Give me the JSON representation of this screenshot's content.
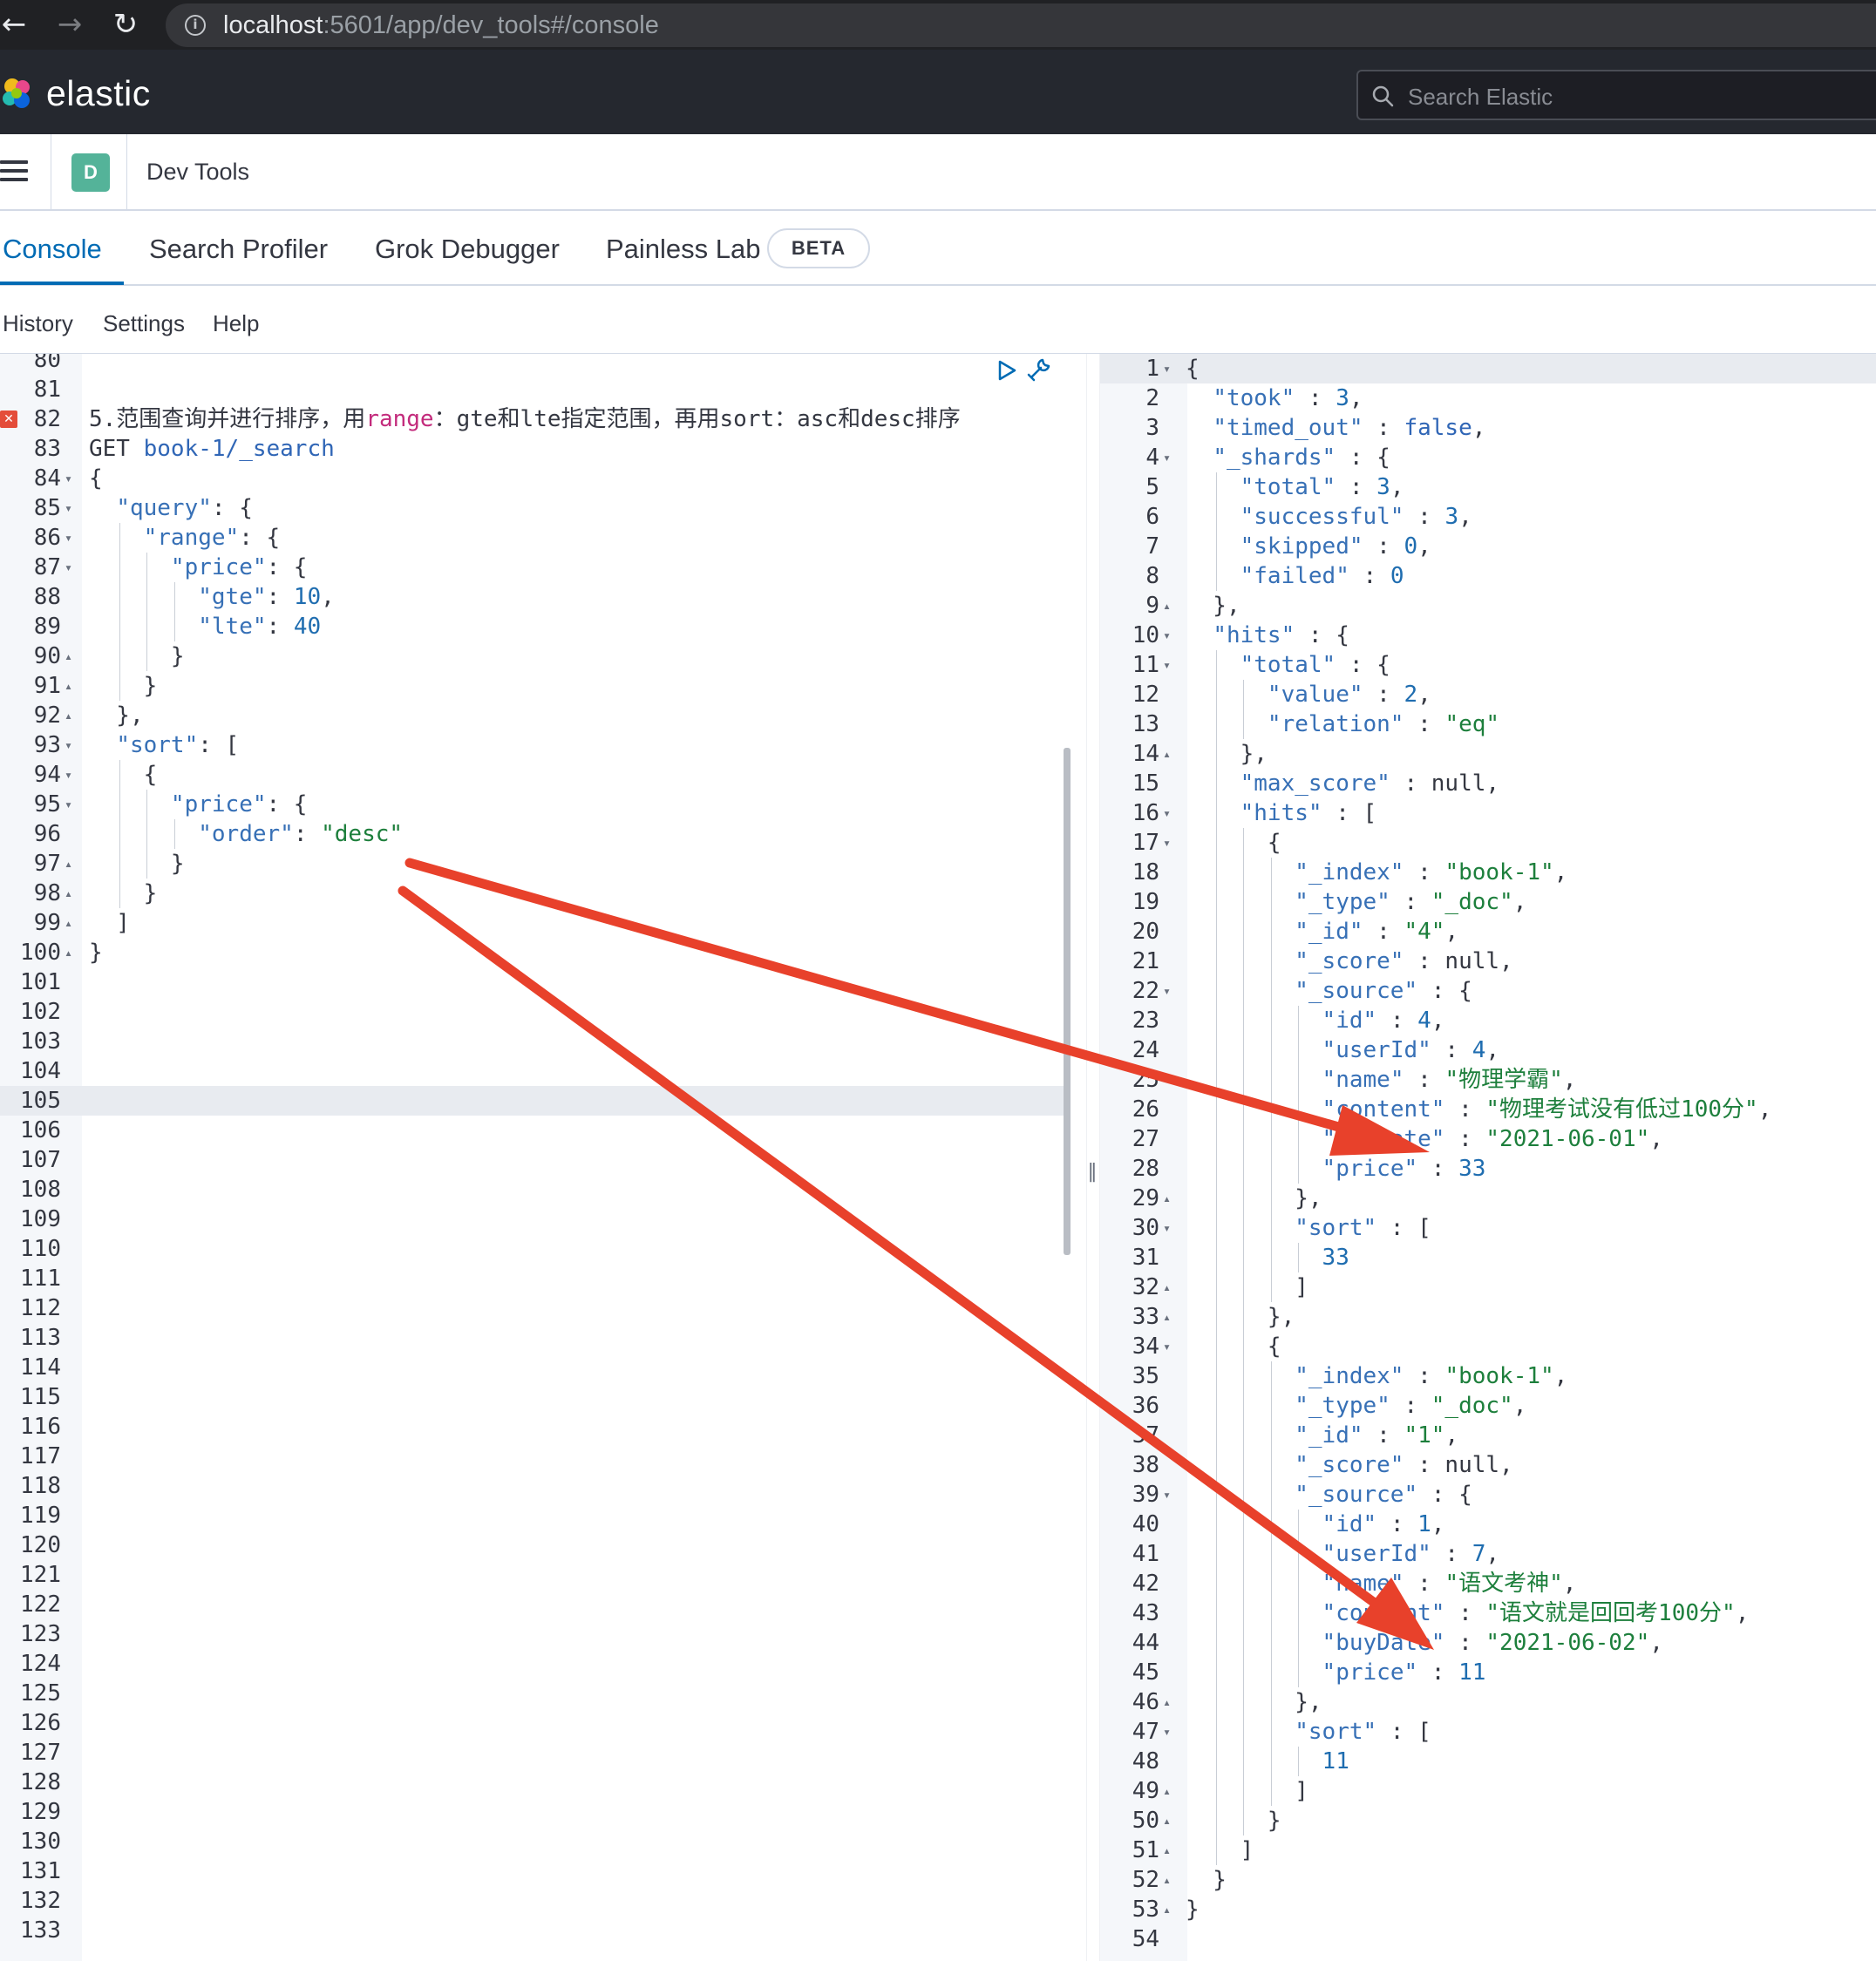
{
  "browser": {
    "url_host": "localhost",
    "url_rest": ":5601/app/dev_tools#/console",
    "back_icon": "←",
    "forward_icon": "→",
    "reload_icon": "↻"
  },
  "header": {
    "brand": "elastic",
    "search_placeholder": "Search Elastic"
  },
  "breadcrumb": {
    "app_badge": "D",
    "title": "Dev Tools"
  },
  "tabs": [
    {
      "label": "Console",
      "active": true
    },
    {
      "label": "Search Profiler"
    },
    {
      "label": "Grok Debugger"
    },
    {
      "label": "Painless Lab"
    }
  ],
  "beta_badge": "BETA",
  "menu": [
    "History",
    "Settings",
    "Help"
  ],
  "colors": {
    "accent": "#006bb4",
    "arrow": "#e8412b",
    "header": "#25282f"
  },
  "request_lines": [
    {
      "n": "80",
      "code": ""
    },
    {
      "n": "81",
      "code": ""
    },
    {
      "n": "82",
      "code": "5.范围查询并进行排序，用range：gte和lte指定范围，再用sort：asc和desc排序",
      "error": true
    },
    {
      "n": "83",
      "code": "GET book-1/_search"
    },
    {
      "n": "84",
      "fold": "▾",
      "code": "{"
    },
    {
      "n": "85",
      "fold": "▾",
      "code": "  \"query\": {"
    },
    {
      "n": "86",
      "fold": "▾",
      "code": "    \"range\": {"
    },
    {
      "n": "87",
      "fold": "▾",
      "code": "      \"price\": {"
    },
    {
      "n": "88",
      "code": "        \"gte\": 10,"
    },
    {
      "n": "89",
      "code": "        \"lte\": 40"
    },
    {
      "n": "90",
      "fold": "▴",
      "code": "      }"
    },
    {
      "n": "91",
      "fold": "▴",
      "code": "    }"
    },
    {
      "n": "92",
      "fold": "▴",
      "code": "  },"
    },
    {
      "n": "93",
      "fold": "▾",
      "code": "  \"sort\": ["
    },
    {
      "n": "94",
      "fold": "▾",
      "code": "    {"
    },
    {
      "n": "95",
      "fold": "▾",
      "code": "      \"price\": {"
    },
    {
      "n": "96",
      "code": "        \"order\": \"desc\""
    },
    {
      "n": "97",
      "fold": "▴",
      "code": "      }"
    },
    {
      "n": "98",
      "fold": "▴",
      "code": "    }"
    },
    {
      "n": "99",
      "fold": "▴",
      "code": "  ]"
    },
    {
      "n": "100",
      "fold": "▴",
      "code": "}"
    },
    {
      "n": "101",
      "code": ""
    },
    {
      "n": "102",
      "code": ""
    },
    {
      "n": "103",
      "code": ""
    },
    {
      "n": "104",
      "code": ""
    },
    {
      "n": "105",
      "code": "",
      "active": true
    },
    {
      "n": "106",
      "code": ""
    },
    {
      "n": "107",
      "code": ""
    },
    {
      "n": "108",
      "code": ""
    },
    {
      "n": "109",
      "code": ""
    },
    {
      "n": "110",
      "code": ""
    },
    {
      "n": "111",
      "code": ""
    },
    {
      "n": "112",
      "code": ""
    },
    {
      "n": "113",
      "code": ""
    },
    {
      "n": "114",
      "code": ""
    },
    {
      "n": "115",
      "code": ""
    },
    {
      "n": "116",
      "code": ""
    },
    {
      "n": "117",
      "code": ""
    },
    {
      "n": "118",
      "code": ""
    },
    {
      "n": "119",
      "code": ""
    },
    {
      "n": "120",
      "code": ""
    },
    {
      "n": "121",
      "code": ""
    },
    {
      "n": "122",
      "code": ""
    },
    {
      "n": "123",
      "code": ""
    },
    {
      "n": "124",
      "code": ""
    },
    {
      "n": "125",
      "code": ""
    },
    {
      "n": "126",
      "code": ""
    },
    {
      "n": "127",
      "code": ""
    },
    {
      "n": "128",
      "code": ""
    },
    {
      "n": "129",
      "code": ""
    },
    {
      "n": "130",
      "code": ""
    },
    {
      "n": "131",
      "code": ""
    },
    {
      "n": "132",
      "code": ""
    },
    {
      "n": "133",
      "code": ""
    }
  ],
  "response_lines": [
    {
      "n": "1",
      "fold": "▾",
      "code": "{"
    },
    {
      "n": "2",
      "code": "  \"took\" : 3,"
    },
    {
      "n": "3",
      "code": "  \"timed_out\" : false,"
    },
    {
      "n": "4",
      "fold": "▾",
      "code": "  \"_shards\" : {"
    },
    {
      "n": "5",
      "code": "    \"total\" : 3,"
    },
    {
      "n": "6",
      "code": "    \"successful\" : 3,"
    },
    {
      "n": "7",
      "code": "    \"skipped\" : 0,"
    },
    {
      "n": "8",
      "code": "    \"failed\" : 0"
    },
    {
      "n": "9",
      "fold": "▴",
      "code": "  },"
    },
    {
      "n": "10",
      "fold": "▾",
      "code": "  \"hits\" : {"
    },
    {
      "n": "11",
      "fold": "▾",
      "code": "    \"total\" : {"
    },
    {
      "n": "12",
      "code": "      \"value\" : 2,"
    },
    {
      "n": "13",
      "code": "      \"relation\" : \"eq\""
    },
    {
      "n": "14",
      "fold": "▴",
      "code": "    },"
    },
    {
      "n": "15",
      "code": "    \"max_score\" : null,"
    },
    {
      "n": "16",
      "fold": "▾",
      "code": "    \"hits\" : ["
    },
    {
      "n": "17",
      "fold": "▾",
      "code": "      {"
    },
    {
      "n": "18",
      "code": "        \"_index\" : \"book-1\","
    },
    {
      "n": "19",
      "code": "        \"_type\" : \"_doc\","
    },
    {
      "n": "20",
      "code": "        \"_id\" : \"4\","
    },
    {
      "n": "21",
      "code": "        \"_score\" : null,"
    },
    {
      "n": "22",
      "fold": "▾",
      "code": "        \"_source\" : {"
    },
    {
      "n": "23",
      "code": "          \"id\" : 4,"
    },
    {
      "n": "24",
      "code": "          \"userId\" : 4,"
    },
    {
      "n": "25",
      "code": "          \"name\" : \"物理学霸\","
    },
    {
      "n": "26",
      "code": "          \"content\" : \"物理考试没有低过100分\","
    },
    {
      "n": "27",
      "code": "          \"buyDate\" : \"2021-06-01\","
    },
    {
      "n": "28",
      "code": "          \"price\" : 33"
    },
    {
      "n": "29",
      "fold": "▴",
      "code": "        },"
    },
    {
      "n": "30",
      "fold": "▾",
      "code": "        \"sort\" : ["
    },
    {
      "n": "31",
      "code": "          33"
    },
    {
      "n": "32",
      "fold": "▴",
      "code": "        ]"
    },
    {
      "n": "33",
      "fold": "▴",
      "code": "      },"
    },
    {
      "n": "34",
      "fold": "▾",
      "code": "      {"
    },
    {
      "n": "35",
      "code": "        \"_index\" : \"book-1\","
    },
    {
      "n": "36",
      "code": "        \"_type\" : \"_doc\","
    },
    {
      "n": "37",
      "code": "        \"_id\" : \"1\","
    },
    {
      "n": "38",
      "code": "        \"_score\" : null,"
    },
    {
      "n": "39",
      "fold": "▾",
      "code": "        \"_source\" : {"
    },
    {
      "n": "40",
      "code": "          \"id\" : 1,"
    },
    {
      "n": "41",
      "code": "          \"userId\" : 7,"
    },
    {
      "n": "42",
      "code": "          \"name\" : \"语文考神\","
    },
    {
      "n": "43",
      "code": "          \"content\" : \"语文就是回回考100分\","
    },
    {
      "n": "44",
      "code": "          \"buyDate\" : \"2021-06-02\","
    },
    {
      "n": "45",
      "code": "          \"price\" : 11"
    },
    {
      "n": "46",
      "fold": "▴",
      "code": "        },"
    },
    {
      "n": "47",
      "fold": "▾",
      "code": "        \"sort\" : ["
    },
    {
      "n": "48",
      "code": "          11"
    },
    {
      "n": "49",
      "fold": "▴",
      "code": "        ]"
    },
    {
      "n": "50",
      "fold": "▴",
      "code": "      }"
    },
    {
      "n": "51",
      "fold": "▴",
      "code": "    ]"
    },
    {
      "n": "52",
      "fold": "▴",
      "code": "  }"
    },
    {
      "n": "53",
      "fold": "▴",
      "code": "}"
    },
    {
      "n": "54",
      "code": ""
    }
  ]
}
